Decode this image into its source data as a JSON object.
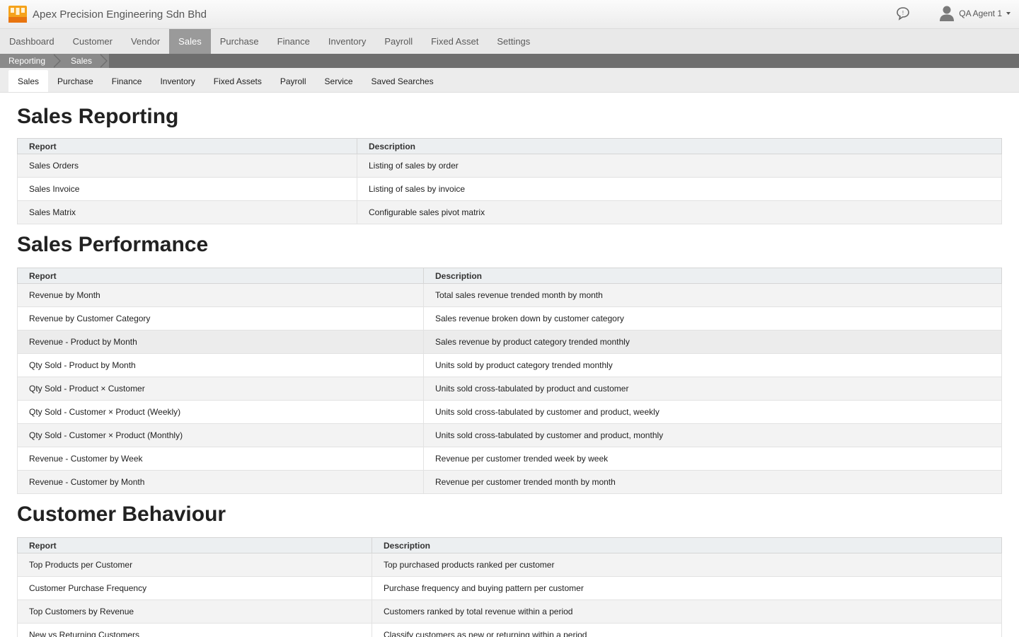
{
  "app": {
    "company_name": "Apex Precision Engineering Sdn Bhd",
    "user_name": "QA Agent 1"
  },
  "main_nav": [
    {
      "label": "Dashboard"
    },
    {
      "label": "Customer"
    },
    {
      "label": "Vendor"
    },
    {
      "label": "Sales",
      "active": true
    },
    {
      "label": "Purchase"
    },
    {
      "label": "Finance"
    },
    {
      "label": "Inventory"
    },
    {
      "label": "Payroll"
    },
    {
      "label": "Fixed Asset"
    },
    {
      "label": "Settings"
    }
  ],
  "breadcrumb": [
    "Reporting",
    "Sales"
  ],
  "sub_nav": [
    {
      "label": "Sales",
      "active": true
    },
    {
      "label": "Purchase"
    },
    {
      "label": "Finance"
    },
    {
      "label": "Inventory"
    },
    {
      "label": "Fixed Assets"
    },
    {
      "label": "Payroll"
    },
    {
      "label": "Service"
    },
    {
      "label": "Saved Searches"
    }
  ],
  "sections": [
    {
      "title": "Sales Reporting",
      "col_report": "Report",
      "col_description": "Description",
      "rows": [
        {
          "report": "Sales Orders",
          "description": "Listing of sales by order"
        },
        {
          "report": "Sales Invoice",
          "description": "Listing of sales by invoice"
        },
        {
          "report": "Sales Matrix",
          "description": "Configurable sales pivot matrix"
        }
      ]
    },
    {
      "title": "Sales Performance",
      "col_report": "Report",
      "col_description": "Description",
      "rows": [
        {
          "report": "Revenue by Month",
          "description": "Total sales revenue trended month by month"
        },
        {
          "report": "Revenue by Customer Category",
          "description": "Sales revenue broken down by customer category"
        },
        {
          "report": "Revenue - Product by Month",
          "description": "Sales revenue by product category trended monthly"
        },
        {
          "report": "Qty Sold - Product by Month",
          "description": "Units sold by product category trended monthly"
        },
        {
          "report": "Qty Sold - Product × Customer",
          "description": "Units sold cross-tabulated by product and customer"
        },
        {
          "report": "Qty Sold - Customer × Product (Weekly)",
          "description": "Units sold cross-tabulated by customer and product, weekly"
        },
        {
          "report": "Qty Sold - Customer × Product (Monthly)",
          "description": "Units sold cross-tabulated by customer and product, monthly"
        },
        {
          "report": "Revenue - Customer by Week",
          "description": "Revenue per customer trended week by week"
        },
        {
          "report": "Revenue - Customer by Month",
          "description": "Revenue per customer trended month by month"
        }
      ]
    },
    {
      "title": "Customer Behaviour",
      "col_report": "Report",
      "col_description": "Description",
      "rows": [
        {
          "report": "Top Products per Customer",
          "description": "Top purchased products ranked per customer"
        },
        {
          "report": "Customer Purchase Frequency",
          "description": "Purchase frequency and buying pattern per customer"
        },
        {
          "report": "Top Customers by Revenue",
          "description": "Customers ranked by total revenue within a period"
        },
        {
          "report": "New vs Returning Customers",
          "description": "Classify customers as new or returning within a period"
        }
      ]
    }
  ]
}
